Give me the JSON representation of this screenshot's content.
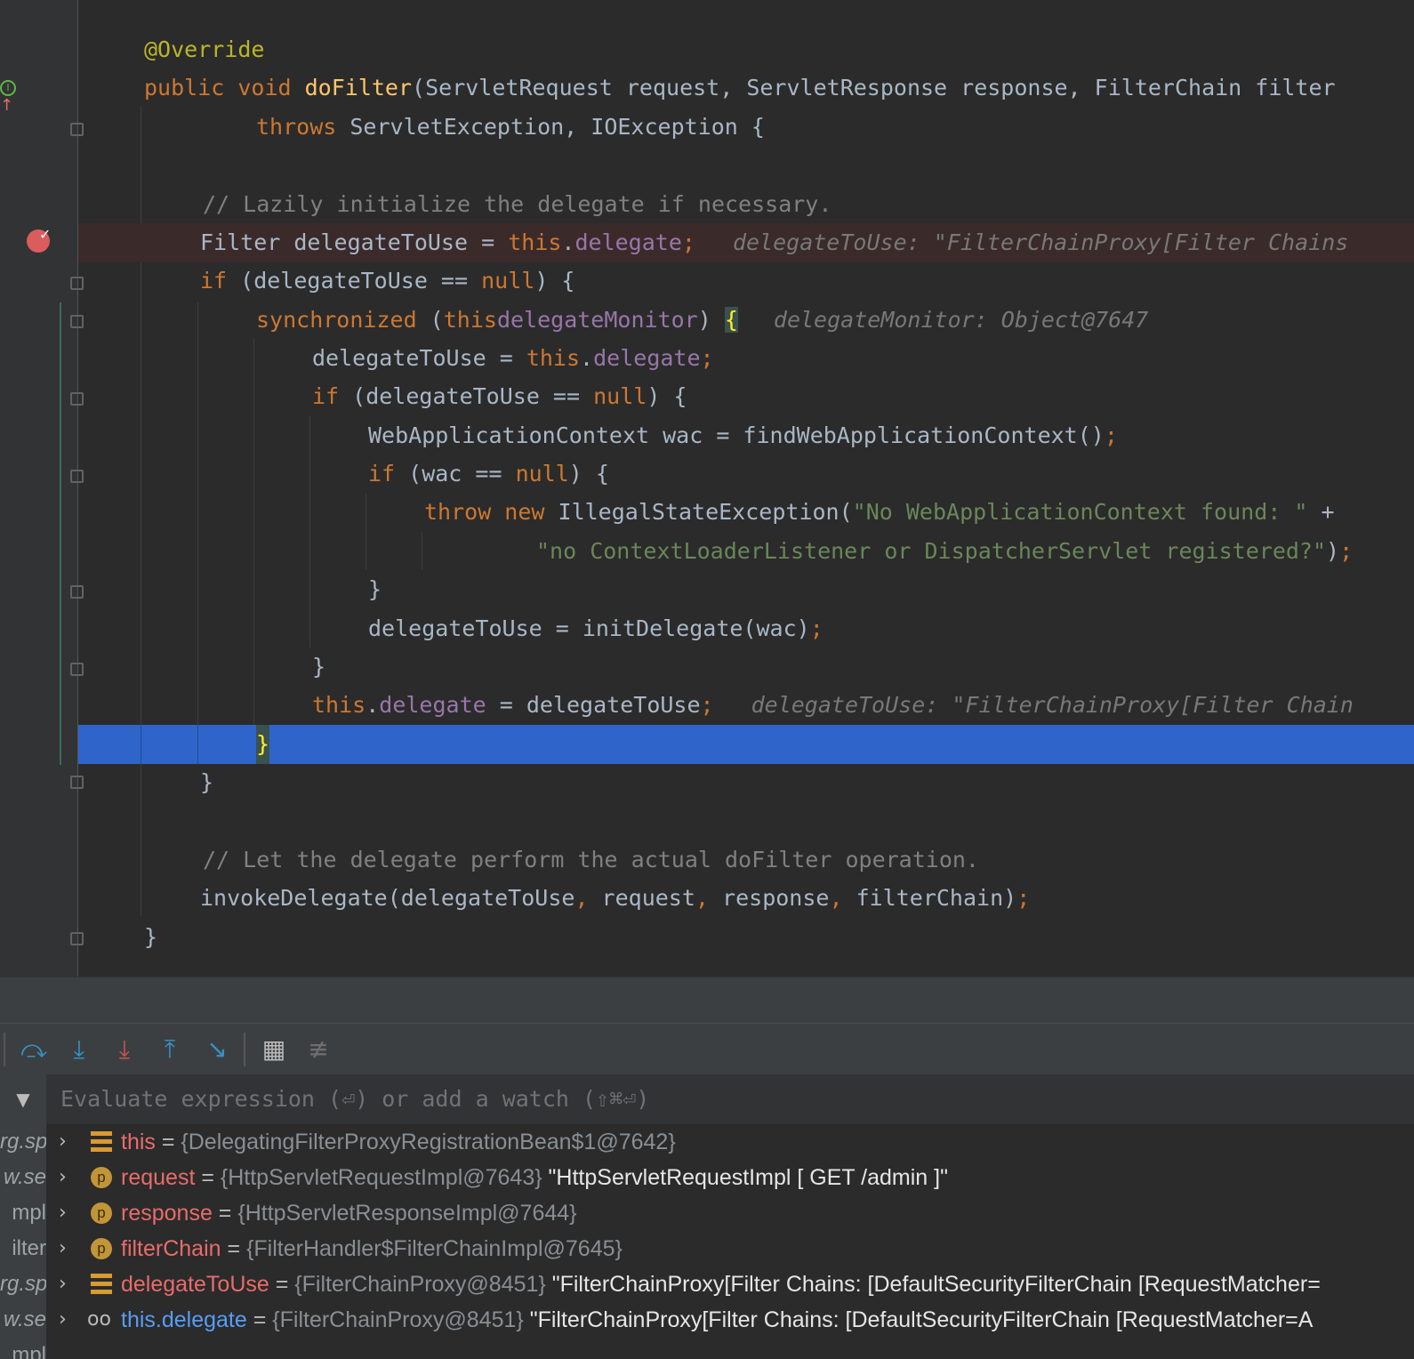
{
  "editor": {
    "lines": [
      {
        "n": "annotation",
        "text": "@Override"
      },
      {
        "n": "signature",
        "t1": "public void ",
        "fn": "doFilter",
        "t2": "(ServletRequest request, ServletResponse response, FilterChain filter"
      },
      {
        "n": "throws",
        "kw": "throws ",
        "t": "ServletException, IOException {"
      },
      {
        "n": "comment1",
        "text": "// Lazily initialize the delegate if necessary."
      },
      {
        "n": "filter-decl",
        "a": "Filter delegateToUse = ",
        "kw": "this",
        "dot": ".",
        "field": "delegate",
        "semi": ";",
        "hint": "delegateToUse: \"FilterChainProxy[Filter Chains"
      },
      {
        "n": "if-null",
        "kw": "if ",
        "t": "(delegateToUse == ",
        "kw2": "null",
        "t2": ") {"
      },
      {
        "n": "synchronized",
        "kw": "synchronized ",
        "t": "(",
        "kw2": "this",
        ".": ".",
        "field": "delegateMonitor",
        "t2": ") ",
        "brace": "{",
        "hint": "delegateMonitor: Object@7647"
      },
      {
        "n": "assign1",
        "a": "delegateToUse = ",
        "kw": "this",
        "dot": ".",
        "field": "delegate",
        "semi": ";"
      },
      {
        "n": "if-null2",
        "kw": "if ",
        "t": "(delegateToUse == ",
        "kw2": "null",
        "t2": ") {"
      },
      {
        "n": "wac-decl",
        "a": "WebApplicationContext wac = findWebApplicationContext()",
        "semi": ";"
      },
      {
        "n": "if-wac",
        "kw": "if ",
        "t": "(wac == ",
        "kw2": "null",
        "t2": ") {"
      },
      {
        "n": "throw",
        "kw": "throw new ",
        "t": "IllegalStateException(",
        "str": "\"No WebApplicationContext found: \"",
        "t2": " +"
      },
      {
        "n": "throw-cont",
        "str": "\"no ContextLoaderListener or DispatcherServlet registered?\"",
        "t2": ")",
        "semi": ";"
      },
      {
        "n": "close1",
        "text": "}"
      },
      {
        "n": "init-delegate",
        "a": "delegateToUse = initDelegate(wac)",
        "semi": ";"
      },
      {
        "n": "close2",
        "text": "}"
      },
      {
        "n": "this-assign",
        "kw": "this",
        "dot": ".",
        "field": "delegate",
        "a": " = delegateToUse",
        "semi": ";",
        "hint": "delegateToUse: \"FilterChainProxy[Filter Chain"
      },
      {
        "n": "exec-close",
        "brace": "}"
      },
      {
        "n": "close3",
        "text": "}"
      },
      {
        "n": "comment2",
        "text": "// Let the delegate perform the actual doFilter operation."
      },
      {
        "n": "invoke",
        "a": "invokeDelegate(delegateToUse",
        "c1": ",",
        "a2": " request",
        "c2": ",",
        "a3": " response",
        "c3": ",",
        "a4": " filterChain)",
        "semi": ";"
      },
      {
        "n": "close4",
        "text": "}"
      }
    ]
  },
  "toolbar": {
    "buttons": [
      "step-over-icon",
      "step-into-icon",
      "force-step-into-icon",
      "step-out-icon",
      "run-to-cursor-icon",
      "evaluate-icon",
      "trace-icon"
    ]
  },
  "eval": {
    "placeholder": "Evaluate expression (⏎) or add a watch (⇧⌘⏎)"
  },
  "frames": [
    "rg.sp",
    "w.se",
    "mpl",
    "ilter",
    "rg.sp",
    "w.se",
    "mpl"
  ],
  "variables": [
    {
      "icon": "list",
      "name": "this",
      "eq": " = ",
      "type": "{DelegatingFilterProxyRegistrationBean$1@7642}",
      "value": ""
    },
    {
      "icon": "p",
      "name": "request",
      "eq": " = ",
      "type": "{HttpServletRequestImpl@7643}",
      "value": " \"HttpServletRequestImpl [ GET /admin ]\""
    },
    {
      "icon": "p",
      "name": "response",
      "eq": " = ",
      "type": "{HttpServletResponseImpl@7644}",
      "value": ""
    },
    {
      "icon": "p",
      "name": "filterChain",
      "eq": " = ",
      "type": "{FilterHandler$FilterChainImpl@7645}",
      "value": ""
    },
    {
      "icon": "list",
      "name": "delegateToUse",
      "eq": " = ",
      "type": "{FilterChainProxy@8451}",
      "value": " \"FilterChainProxy[Filter Chains: [DefaultSecurityFilterChain [RequestMatcher="
    },
    {
      "icon": "watch",
      "name": "this.delegate",
      "eq": " = ",
      "type": "{FilterChainProxy@8451}",
      "value": " \"FilterChainProxy[Filter Chains: [DefaultSecurityFilterChain [RequestMatcher=A"
    }
  ],
  "icons": {
    "param": "p",
    "watch": "oo"
  }
}
